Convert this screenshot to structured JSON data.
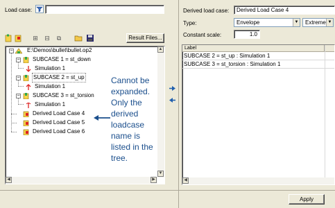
{
  "left": {
    "load_case_label": "Load case:",
    "load_case_value": "",
    "result_files_button": "Result Files...",
    "toolbar_icons": [
      "add-load-case-icon",
      "add-derived-icon",
      "expand-all-icon",
      "collapse-all-icon",
      "copy-icon",
      "open-folder-icon",
      "save-icon"
    ]
  },
  "tree": {
    "root": "E:\\Demos\\bullet\\bullet.op2",
    "items": [
      {
        "label": "SUBCASE 1 = st_down",
        "child": "Simulation 1"
      },
      {
        "label": "SUBCASE 2 = st_up",
        "child": "Simulation 1"
      },
      {
        "label": "SUBCASE 3 = st_torsion",
        "child": "Simulation 1"
      }
    ],
    "derived": [
      "Derived Load Case 4",
      "Derived Load Case 5",
      "Derived Load Case 6"
    ]
  },
  "callout": {
    "text": "Cannot be expanded. Only the derived loadcase name is listed in the tree."
  },
  "right": {
    "derived_label": "Derived load case:",
    "derived_value": "Derived Load Case 4",
    "type_label": "Type:",
    "type_value": "Envelope",
    "type_extra_value": "Extreme",
    "scale_label": "Constant scale:",
    "scale_value": "1.0",
    "table_header": "Label",
    "rows": [
      "SUBCASE 2 = st_up : Simulation 1",
      "SUBCASE 3 = st_torsion : Simulation 1"
    ]
  },
  "footer": {
    "apply_button": "Apply"
  },
  "colors": {
    "window_bg": "#ece9d8",
    "callout_text": "#1a4e8c",
    "arrow_blue": "#1f5fae",
    "selection_outline": "#808080"
  }
}
